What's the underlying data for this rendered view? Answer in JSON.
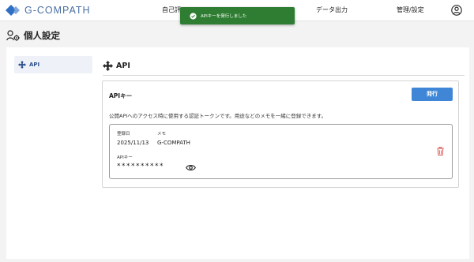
{
  "app": {
    "logo_text": "G-COMPATH"
  },
  "nav": [
    {
      "label": "自己評"
    },
    {
      "label": "データ出力"
    },
    {
      "label": "管理/設定"
    }
  ],
  "toast": {
    "message": "APIキーを発行しました"
  },
  "page": {
    "title": "個人設定"
  },
  "sidebar": {
    "items": [
      {
        "label": "API"
      }
    ]
  },
  "section": {
    "title": "API"
  },
  "api_card": {
    "title": "APIキー",
    "issue_button": "発行",
    "description": "公開APIへのアクセス時に使用する認証トークンです。用途などのメモを一緒に登録できます。",
    "entries": [
      {
        "date_label": "登録日",
        "date_value": "2025/11/13",
        "memo_label": "メモ",
        "memo_value": "G-COMPATH",
        "key_label": "APIキー",
        "key_value": "**********"
      }
    ]
  },
  "colors": {
    "brand": "#4a6fa5",
    "toast": "#2e7d32",
    "primary_button": "#3f87d6",
    "danger": "#d9534f"
  }
}
